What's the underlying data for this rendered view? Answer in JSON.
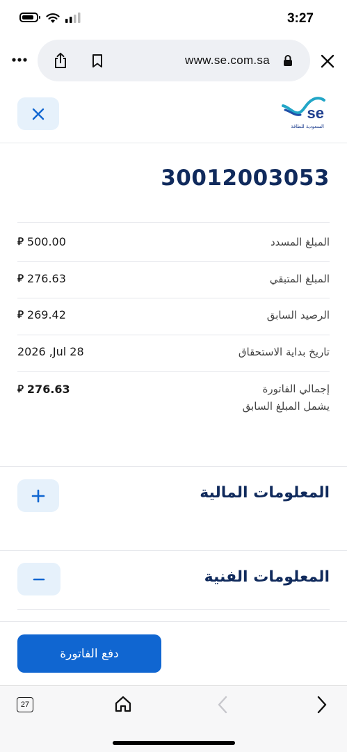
{
  "status_bar": {
    "time": "3:27"
  },
  "browser": {
    "url": "www.se.com.sa",
    "tab_count": "27"
  },
  "header": {
    "logo_text": "se",
    "logo_subtext": "السعودية للطاقة"
  },
  "bill": {
    "account_number": "30012003053",
    "currency_symbol": "⃁",
    "rows": [
      {
        "label": "المبلغ المسدد",
        "value": "500.00"
      },
      {
        "label": "المبلغ المتبقي",
        "value": "276.63"
      },
      {
        "label": "الرصيد السابق",
        "value": "269.42"
      },
      {
        "label": "تاريخ بداية الاستحقاق",
        "value": "2026 ,Jul 28"
      }
    ],
    "total": {
      "label": "إجمالي الفاتورة",
      "sublabel": "يشمل المبلغ السابق",
      "value": "276.63"
    }
  },
  "sections": {
    "financial_title": "المعلومات المالية",
    "technical_title": "المعلومات الفنية"
  },
  "actions": {
    "pay_label": "دفع الفاتورة"
  },
  "colors": {
    "brand_blue": "#1066d1",
    "navy": "#102a5c",
    "light_blue_bg": "#e6f1fb"
  }
}
